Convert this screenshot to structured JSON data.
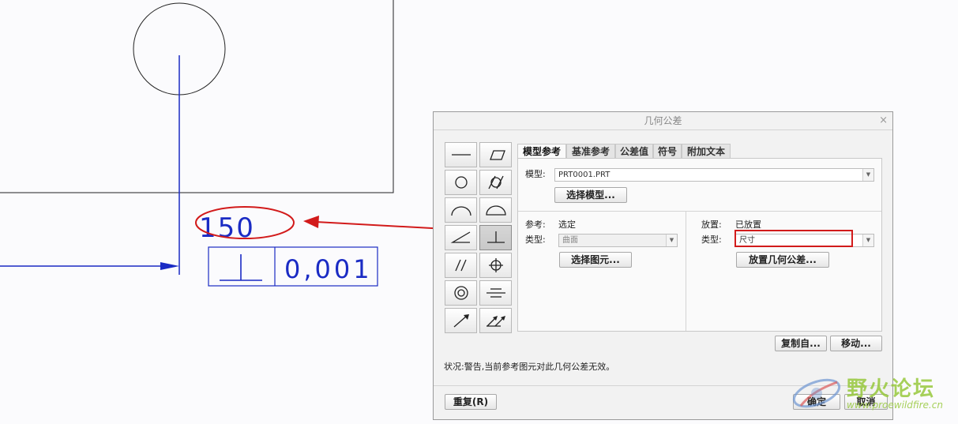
{
  "drawing": {
    "dimension_text": "150",
    "tolerance_value": "0,001",
    "tolerance_symbol": "⊥"
  },
  "dialog": {
    "title": "几何公差",
    "close_label": "×",
    "tabs": [
      {
        "label": "模型参考",
        "active": true
      },
      {
        "label": "基准参考",
        "active": false
      },
      {
        "label": "公差值",
        "active": false
      },
      {
        "label": "符号",
        "active": false
      },
      {
        "label": "附加文本",
        "active": false
      }
    ],
    "model": {
      "label": "模型:",
      "value": "PRT0001.PRT",
      "select_button": "选择模型..."
    },
    "reference": {
      "label": "参考:",
      "status": "选定",
      "type_label": "类型:",
      "type_value": "曲面",
      "select_button": "选择图元..."
    },
    "placement": {
      "label": "放置:",
      "status": "已放置",
      "type_label": "类型:",
      "type_value": "尺寸",
      "place_button": "放置几何公差..."
    },
    "copy_button": "复制自...",
    "move_button": "移动...",
    "status_text": "状况:警告,当前参考图元对此几何公差无效。",
    "repeat_button": "重复(R)",
    "ok_button": "确定",
    "cancel_button": "取消"
  },
  "watermark": {
    "title": "野火论坛",
    "url": "www.proewildfire.cn"
  },
  "colors": {
    "drawing_blue": "#1a2bc4",
    "annotation_red": "#d21b1b"
  }
}
